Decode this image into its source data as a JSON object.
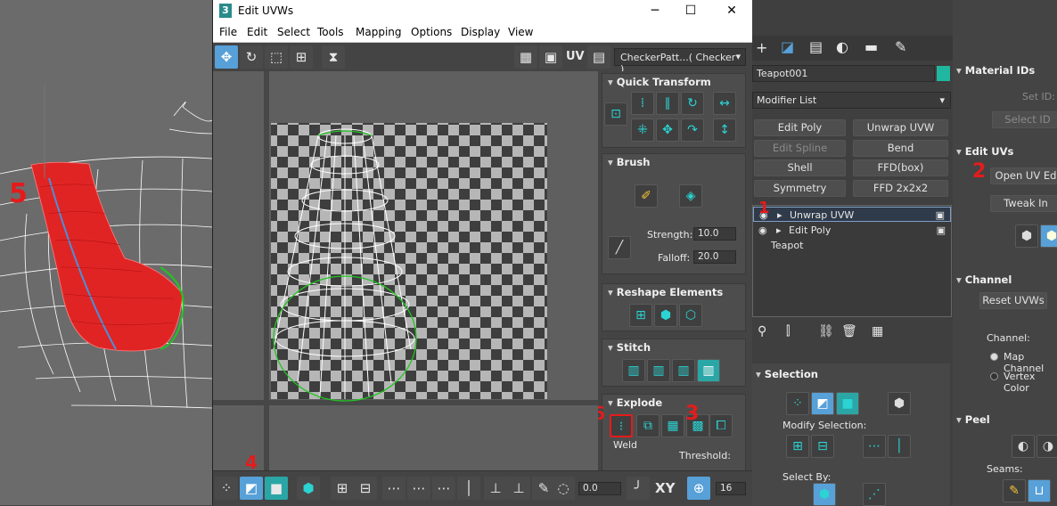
{
  "window": {
    "title": "Edit UVWs",
    "app_icon": "3"
  },
  "menu": [
    "File",
    "Edit",
    "Select",
    "Tools",
    "Mapping",
    "Options",
    "Display",
    "View"
  ],
  "toolbar": {
    "uv_label": "UV",
    "checker_select": "CheckerPatt...( Checker )"
  },
  "rollouts": {
    "quick_transform": "Quick Transform",
    "brush": "Brush",
    "strength_label": "Strength:",
    "strength_value": "10.0",
    "falloff_label": "Falloff:",
    "falloff_value": "20.0",
    "reshape": "Reshape Elements",
    "stitch": "Stitch",
    "explode": "Explode",
    "weld_label": "Weld",
    "threshold_label": "Threshold:"
  },
  "bottom": {
    "value": "0.0",
    "xy": "XY",
    "num": "16"
  },
  "cmd": {
    "object_name": "Teapot001",
    "object_color": "#1fb7a0",
    "modifier_list": "Modifier List",
    "buttons": [
      "Edit Poly",
      "Unwrap UVW",
      "Edit Spline",
      "Bend",
      "Shell",
      "FFD(box)",
      "Symmetry",
      "FFD 2x2x2"
    ],
    "stack": [
      "Unwrap UVW",
      "Edit Poly",
      "Teapot"
    ],
    "selection_title": "Selection",
    "modify_selection": "Modify Selection:",
    "select_by": "Select By:"
  },
  "far": {
    "material_ids": "Material IDs",
    "set_id": "Set ID:",
    "select_id": "Select ID",
    "edit_uvs": "Edit UVs",
    "open_uv": "Open UV Ed",
    "tweak": "Tweak In",
    "channel": "Channel",
    "reset_uvws": "Reset UVWs",
    "channel_label": "Channel:",
    "map_channel": "Map Channel",
    "vertex_color": "Vertex Color",
    "peel": "Peel",
    "seams": "Seams:"
  },
  "annotations": [
    "1",
    "2",
    "3",
    "4",
    "5",
    "6"
  ],
  "colors": {
    "accent": "#57a0d8",
    "teal": "#2bd3d3",
    "red": "#e51b1b",
    "green": "#21c521"
  }
}
